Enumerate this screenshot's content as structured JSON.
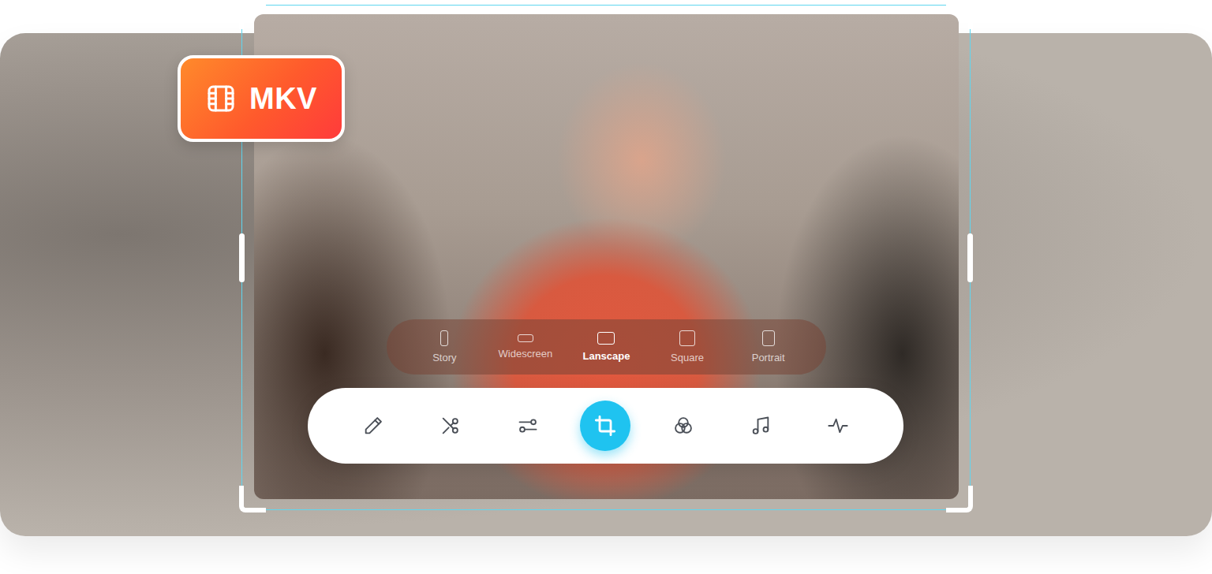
{
  "badge": {
    "label": "MKV"
  },
  "aspect_ratios": [
    {
      "label": "Story",
      "selected": false
    },
    {
      "label": "Widescreen",
      "selected": false
    },
    {
      "label": "Lanscape",
      "selected": true
    },
    {
      "label": "Square",
      "selected": false
    },
    {
      "label": "Portrait",
      "selected": false
    }
  ],
  "tools": [
    {
      "selected": false
    },
    {
      "selected": false
    },
    {
      "selected": false
    },
    {
      "selected": true
    },
    {
      "selected": false
    },
    {
      "selected": false
    },
    {
      "selected": false
    }
  ]
}
